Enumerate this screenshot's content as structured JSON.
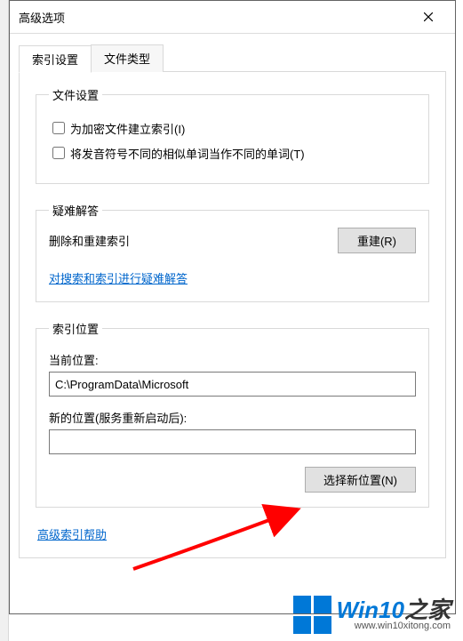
{
  "window": {
    "title": "高级选项"
  },
  "tabs": {
    "index": "索引设置",
    "filetype": "文件类型"
  },
  "file_settings": {
    "legend": "文件设置",
    "encrypted": "为加密文件建立索引(I)",
    "diacritics": "将发音符号不同的相似单词当作不同的单词(T)"
  },
  "troubleshoot": {
    "legend": "疑难解答",
    "desc": "删除和重建索引",
    "rebuild_btn": "重建(R)",
    "link": "对搜索和索引进行疑难解答"
  },
  "index_location": {
    "legend": "索引位置",
    "current_label": "当前位置:",
    "current_value": "C:\\ProgramData\\Microsoft",
    "new_label": "新的位置(服务重新启动后):",
    "new_value": "",
    "select_btn": "选择新位置(N)"
  },
  "help_link": "高级索引帮助",
  "watermark": {
    "brand_prefix": "Win10",
    "brand_suffix": "之家",
    "url": "www.win10xitong.com"
  }
}
